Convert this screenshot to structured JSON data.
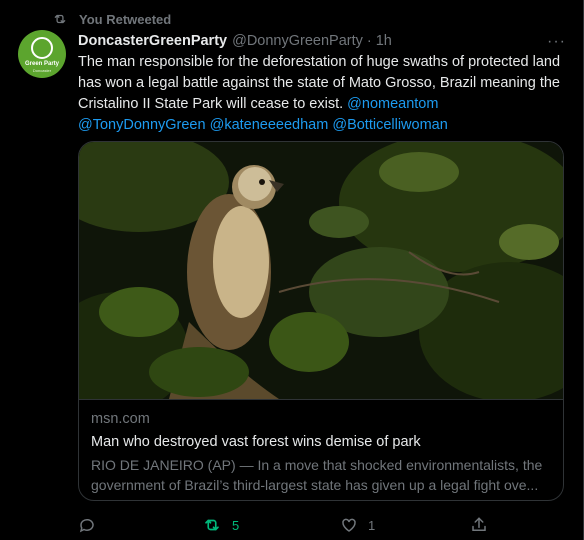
{
  "retweet": {
    "label": "You Retweeted",
    "icon": "retweet-icon"
  },
  "tweet": {
    "avatar": {
      "line1": "Green Party",
      "line2": "Doncaster",
      "icon": "green-party-logo"
    },
    "display_name": "DoncasterGreenParty",
    "handle": "@DonnyGreenParty",
    "separator": "·",
    "time": "1h",
    "more": "···",
    "text_parts": [
      "The man responsible for the deforestation of huge swaths of protected land has won a legal battle against the state of Mato Grosso, Brazil meaning the Cristalino II State Park will cease to exist. ",
      "@nomeantom",
      " ",
      "@TonyDonnyGreen",
      " ",
      "@kateneeeedham",
      " ",
      "@Botticelliwoman"
    ],
    "card": {
      "image": "hawk-perched-among-leaves",
      "domain": "msn.com",
      "title": "Man who destroyed vast forest wins demise of park",
      "description": "RIO DE JANEIRO (AP) — In a move that shocked environmentalists, the government of Brazil’s third-largest state has given up a legal fight ove..."
    },
    "actions": {
      "reply": {
        "icon": "reply-icon",
        "count": ""
      },
      "retweet": {
        "icon": "retweet-icon",
        "count": "5",
        "active": true
      },
      "like": {
        "icon": "heart-icon",
        "count": "1"
      },
      "share": {
        "icon": "share-icon",
        "count": ""
      }
    }
  },
  "colors": {
    "background": "#000000",
    "text": "#e7e9ea",
    "muted": "#71767b",
    "link": "#1d9bf0",
    "retweet_active": "#00ba7c",
    "border": "#2f3336",
    "avatar": "#5ca52e"
  }
}
